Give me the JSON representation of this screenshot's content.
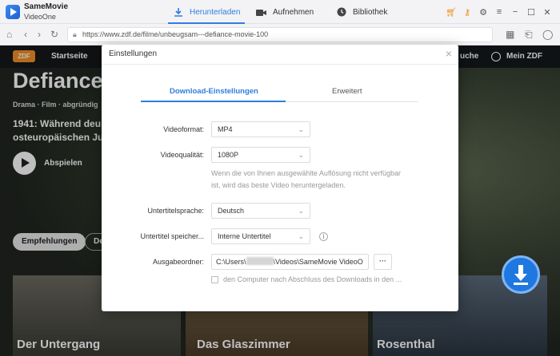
{
  "app": {
    "name": "SameMovie",
    "subtitle": "VideoOne"
  },
  "main_tabs": [
    {
      "label": "Herunterladen",
      "icon": "download-icon",
      "active": true
    },
    {
      "label": "Aufnehmen",
      "icon": "camera-icon",
      "active": false
    },
    {
      "label": "Bibliothek",
      "icon": "clock-icon",
      "active": false
    }
  ],
  "address_bar": {
    "url": "https://www.zdf.de/filme/unbeugsam---defiance-movie-100"
  },
  "site": {
    "logo": "ZDF",
    "nav": {
      "home": "Startseite",
      "search": "uche",
      "account": "Mein ZDF"
    },
    "title": "Defiance",
    "genre": "Drama · Film · abgründig",
    "description_line1": "1941: Während deu",
    "description_line2": "osteuropäischen Ju",
    "play_label": "Abspielen",
    "pill_1": "Empfehlungen",
    "pill_2": "De",
    "cards": [
      {
        "title": "Der Untergang"
      },
      {
        "title": "Das Glaszimmer"
      },
      {
        "title": "Rosenthal"
      }
    ]
  },
  "settings": {
    "title": "Einstellungen",
    "close": "×",
    "tab_download": "Download-Einstellungen",
    "tab_advanced": "Erweitert",
    "video_format_label": "Videoformat:",
    "video_format_value": "MP4",
    "video_quality_label": "Videoqualität:",
    "video_quality_value": "1080P",
    "quality_note": "Wenn die von Ihnen ausgewählte Auflösung nicht verfügbar ist, wird das beste Video heruntergeladen.",
    "subtitle_lang_label": "Untertitelsprache:",
    "subtitle_lang_value": "Deutsch",
    "subtitle_save_label": "Untertitel speicher...",
    "subtitle_save_value": "Interne Untertitel",
    "output_folder_label": "Ausgabeordner:",
    "output_path_prefix": "C:\\Users\\",
    "output_path_suffix": "\\Videos\\SameMovie VideoO",
    "browse_label": "···",
    "shutdown_label": "den Computer nach Abschluss des Downloads in den ...",
    "shutdown_checked": false
  },
  "colors": {
    "accent": "#2f7de1",
    "zdf_orange": "#f38f24"
  }
}
